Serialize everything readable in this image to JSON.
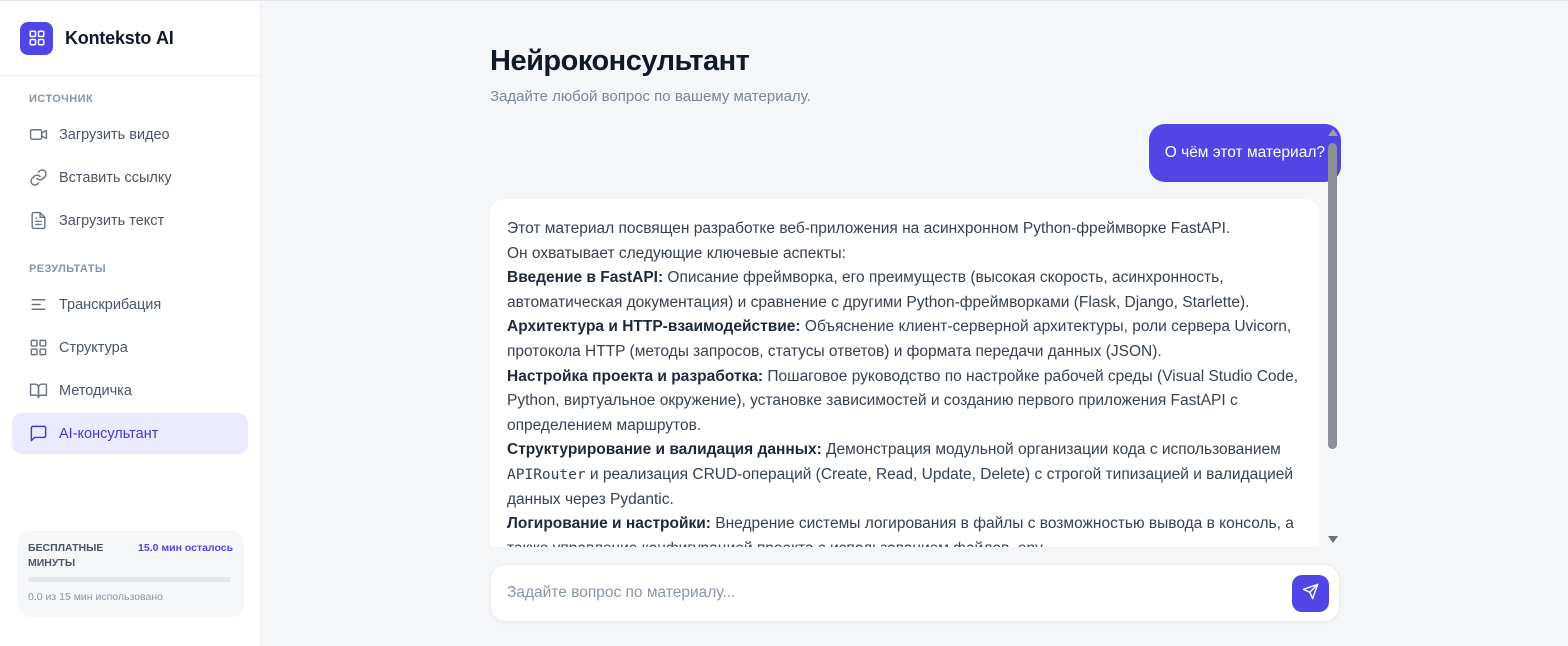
{
  "brand": {
    "name": "Kontekstо AI",
    "icon": "grid-icon",
    "accent": "#4f46e5"
  },
  "sidebar": {
    "source_title": "Источник",
    "source_items": [
      {
        "label": "Загрузить видео",
        "icon": "video-icon"
      },
      {
        "label": "Вставить ссылку",
        "icon": "link-icon"
      },
      {
        "label": "Загрузить текст",
        "icon": "file-text-icon"
      }
    ],
    "results_title": "Результаты",
    "results_items": [
      {
        "label": "Транскрибация",
        "icon": "align-left-icon"
      },
      {
        "label": "Структура",
        "icon": "grid-icon"
      },
      {
        "label": "Методичка",
        "icon": "book-icon"
      },
      {
        "label": "AI-консультант",
        "icon": "message-square-icon",
        "active": true
      }
    ],
    "minutes": {
      "label": "Бесплатные минуты",
      "left": "15.0 мин осталось",
      "used_text": "0.0 из 15 мин использовано",
      "used_fraction": 0
    }
  },
  "main": {
    "title": "Нейроконсультант",
    "subtitle": "Задайте любой вопрос по вашему материалу.",
    "user_message": "О чём этот материал?",
    "bot_message": {
      "intro1": "Этот материал посвящен разработке веб-приложения на асинхронном Python-фреймворке FastAPI.",
      "intro2": "Он охватывает следующие ключевые аспекты:",
      "points": [
        {
          "title": "Введение в FastAPI:",
          "text": " Описание фреймворка, его преимуществ (высокая скорость, асинхронность, автоматическая документация) и сравнение с другими Python-фреймворками (Flask, Django, Starlette)."
        },
        {
          "title": "Архитектура и HTTP-взаимодействие:",
          "text": " Объяснение клиент-серверной архитектуры, роли сервера Uvicorn, протокола HTTP (методы запросов, статусы ответов) и формата передачи данных (JSON)."
        },
        {
          "title": "Настройка проекта и разработка:",
          "text": " Пошаговое руководство по настройке рабочей среды (Visual Studio Code, Python, виртуальное окружение), установке зависимостей и созданию первого приложения FastAPI с определением маршрутов."
        },
        {
          "title": "Структурирование и валидация данных:",
          "text_before": " Демонстрация модульной организации кода с использованием ",
          "code": "APIRouter",
          "text_after": " и реализация CRUD-операций (Create, Read, Update, Delete) с строгой типизацией и валидацией данных через Pydantic."
        },
        {
          "title": "Логирование и настройки:",
          "text": " Внедрение системы логирования в файлы с возможностью вывода в консоль, а также управление конфигурацией проекта с использованием файлов .env."
        }
      ]
    },
    "input": {
      "placeholder": "Задайте вопрос по материалу..."
    },
    "send_icon": "send-icon"
  }
}
